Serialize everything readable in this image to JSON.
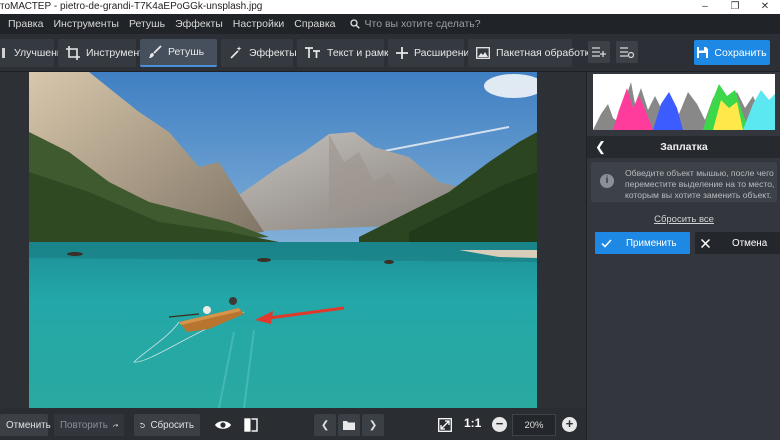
{
  "titlebar": {
    "title": "тоМАСТЕР - pietro-de-grandi-T7K4aEPoGGk-unsplash.jpg"
  },
  "menu": {
    "items": [
      "Правка",
      "Инструменты",
      "Ретушь",
      "Эффекты",
      "Настройки",
      "Справка"
    ],
    "search_placeholder": "Что вы хотите сделать?"
  },
  "toolbar": {
    "tabs": [
      "Улучшения",
      "Инструменты",
      "Ретушь",
      "Эффекты",
      "Текст и рамки",
      "Расширения"
    ],
    "active_tab": "Ретушь",
    "batch_label": "Пакетная обработка",
    "save_label": "Сохранить"
  },
  "panel": {
    "title": "Заплатка",
    "hint": "Обведите объект мышью, после чего переместите выделение на то место, которым вы хотите заменить объект.",
    "reset_label": "Сбросить все",
    "apply_label": "Применить",
    "cancel_label": "Отмена"
  },
  "bottombar": {
    "undo_label": "Отменить",
    "redo_label": "Повторить",
    "reset_label": "Сбросить",
    "ratio_label": "1:1",
    "zoom_value": "20%"
  },
  "colors": {
    "accent": "#1e88e5",
    "arrow": "#e0392b"
  }
}
